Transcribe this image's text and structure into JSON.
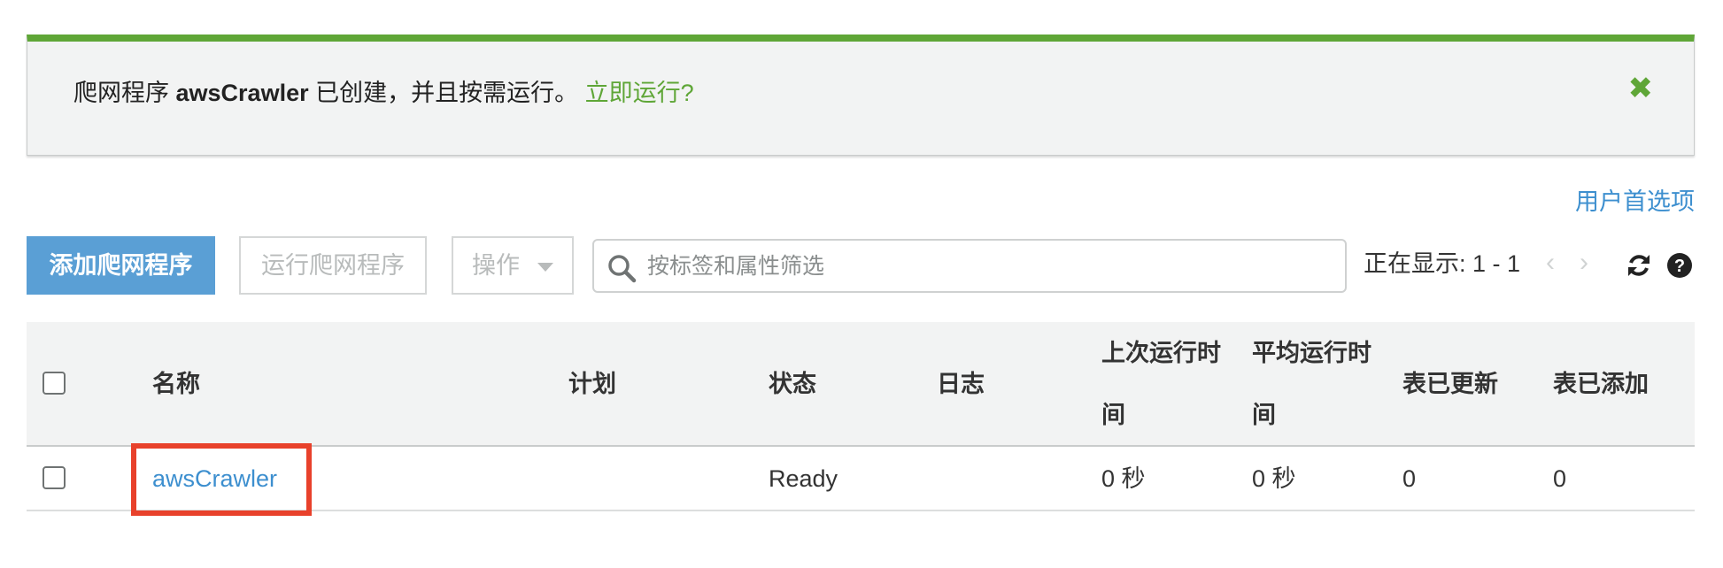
{
  "flash": {
    "prefix": "爬网程序 ",
    "crawler_name": "awsCrawler",
    "suffix": " 已创建，并且按需运行。",
    "run_now": "立即运行?",
    "close_icon": "close-icon",
    "accent_color": "#5fa637"
  },
  "user_preferences": "用户首选项",
  "toolbar": {
    "add_crawler": "添加爬网程序",
    "run_crawler": "运行爬网程序",
    "actions": "操作",
    "search_placeholder": "按标签和属性筛选",
    "showing": "正在显示: 1 - 1",
    "prev": "‹",
    "next": "›"
  },
  "table": {
    "headers": {
      "name": "名称",
      "schedule": "计划",
      "status": "状态",
      "logs": "日志",
      "last_runtime": "上次运行时间",
      "avg_runtime": "平均运行时间",
      "tables_updated": "表已更新",
      "tables_added": "表已添加"
    },
    "rows": [
      {
        "name": "awsCrawler",
        "schedule": "",
        "status": "Ready",
        "logs": "",
        "last_runtime": "0 秒",
        "avg_runtime": "0 秒",
        "tables_updated": "0",
        "tables_added": "0"
      }
    ]
  },
  "colors": {
    "primary": "#5a9fd5",
    "link": "#3d8fcf",
    "success": "#5fa637",
    "highlight": "#e8412b"
  }
}
